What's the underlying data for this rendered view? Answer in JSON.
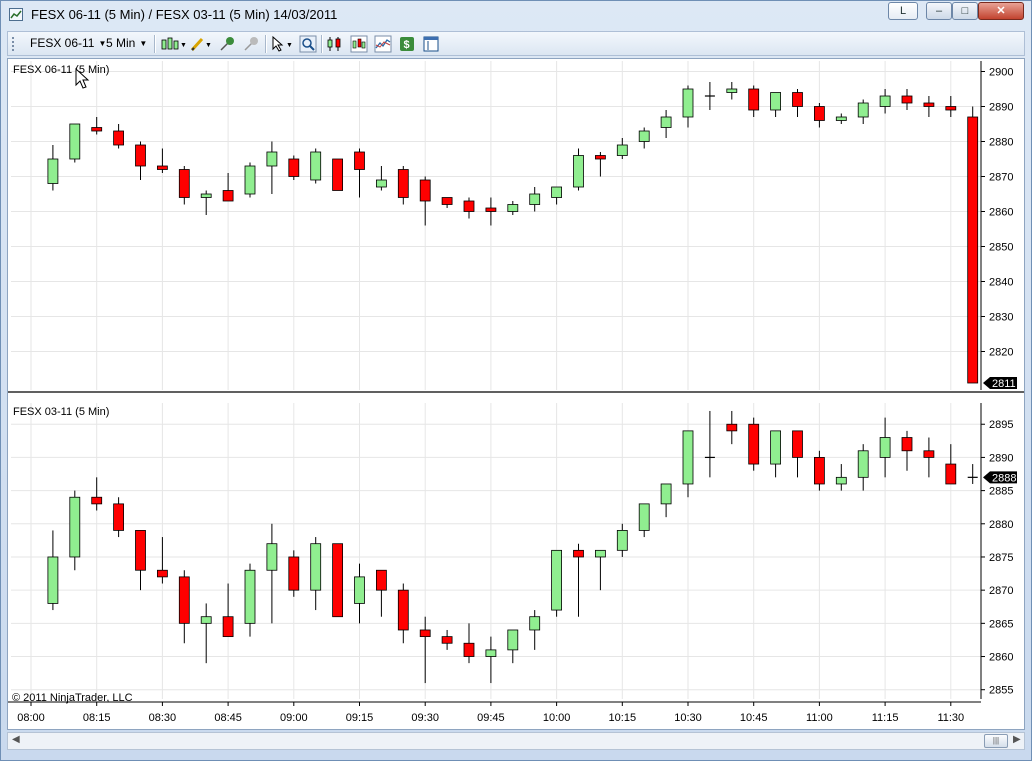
{
  "window": {
    "title": "FESX 06-11 (5 Min) / FESX 03-11 (5 Min)  14/03/2011",
    "link_button_label": "L"
  },
  "toolbar": {
    "instrument": "FESX 06-11",
    "interval": "5 Min",
    "icons": [
      "bar-type-icon",
      "pencil-draw-icon",
      "pin-icon",
      "pin-gray-icon",
      "cursor-icon",
      "zoom-icon",
      "data-box-icon",
      "chart-style-icon",
      "indicators-icon",
      "strategy-dollar-icon",
      "properties-icon"
    ]
  },
  "colors": {
    "up": "#90ee90",
    "down": "#ff0000",
    "grid": "#e6e6e6",
    "divider": "#000000"
  },
  "footer": {
    "copyright": "© 2011 NinjaTrader, LLC"
  },
  "chart_data": [
    {
      "type": "candlestick",
      "title": "FESX 06-11 (5 Min)",
      "yticks": [
        2820,
        2830,
        2840,
        2850,
        2860,
        2870,
        2880,
        2890,
        2900
      ],
      "ylim": [
        2809,
        2903
      ],
      "last_price": "2811",
      "x": [
        "08:05",
        "08:10",
        "08:15",
        "08:20",
        "08:25",
        "08:30",
        "08:35",
        "08:40",
        "08:45",
        "08:50",
        "08:55",
        "09:00",
        "09:05",
        "09:10",
        "09:15",
        "09:20",
        "09:25",
        "09:30",
        "09:35",
        "09:40",
        "09:45",
        "09:50",
        "09:55",
        "10:00",
        "10:05",
        "10:10",
        "10:15",
        "10:20",
        "10:25",
        "10:30",
        "10:35",
        "10:40",
        "10:45",
        "10:50",
        "10:55",
        "11:00",
        "11:05",
        "11:10",
        "11:15",
        "11:20",
        "11:25",
        "11:30",
        "11:35"
      ],
      "open": [
        2868,
        2875,
        2884,
        2883,
        2879,
        2873,
        2872,
        2864,
        2866,
        2865,
        2873,
        2875,
        2869,
        2875,
        2877,
        2867,
        2872,
        2869,
        2864,
        2863,
        2861,
        2860,
        2862,
        2864,
        2867,
        2876,
        2876,
        2880,
        2884,
        2887,
        2893,
        2894,
        2895,
        2889,
        2894,
        2890,
        2886,
        2887,
        2890,
        2893,
        2891,
        2890,
        2887
      ],
      "high": [
        2879,
        2885,
        2887,
        2885,
        2880,
        2878,
        2873,
        2866,
        2871,
        2874,
        2880,
        2876,
        2878,
        2875,
        2878,
        2873,
        2873,
        2870,
        2864,
        2864,
        2864,
        2863,
        2867,
        2867,
        2878,
        2877,
        2881,
        2884,
        2889,
        2896,
        2897,
        2897,
        2896,
        2891,
        2895,
        2891,
        2888,
        2892,
        2895,
        2895,
        2893,
        2893,
        2890
      ],
      "low": [
        2866,
        2874,
        2882,
        2878,
        2869,
        2871,
        2862,
        2859,
        2863,
        2864,
        2865,
        2869,
        2868,
        2866,
        2864,
        2866,
        2862,
        2856,
        2861,
        2858,
        2856,
        2859,
        2860,
        2862,
        2866,
        2870,
        2875,
        2878,
        2881,
        2884,
        2889,
        2892,
        2887,
        2887,
        2887,
        2884,
        2885,
        2885,
        2888,
        2889,
        2887,
        2887,
        2885
      ],
      "close": [
        2875,
        2885,
        2883,
        2879,
        2873,
        2872,
        2864,
        2865,
        2863,
        2873,
        2877,
        2870,
        2877,
        2866,
        2872,
        2869,
        2864,
        2863,
        2862,
        2860,
        2860,
        2862,
        2865,
        2867,
        2876,
        2875,
        2879,
        2883,
        2887,
        2895,
        2893,
        2895,
        2889,
        2894,
        2890,
        2886,
        2887,
        2891,
        2893,
        2891,
        2890,
        2889,
        2811
      ]
    },
    {
      "type": "candlestick",
      "title": "FESX 03-11 (5 Min)",
      "yticks": [
        2855,
        2860,
        2865,
        2870,
        2875,
        2880,
        2885,
        2890,
        2895
      ],
      "ylim": [
        2853.6,
        2898.2
      ],
      "last_price": "2888",
      "x": [
        "08:05",
        "08:10",
        "08:15",
        "08:20",
        "08:25",
        "08:30",
        "08:35",
        "08:40",
        "08:45",
        "08:50",
        "08:55",
        "09:00",
        "09:05",
        "09:10",
        "09:15",
        "09:20",
        "09:25",
        "09:30",
        "09:35",
        "09:40",
        "09:45",
        "09:50",
        "09:55",
        "10:00",
        "10:05",
        "10:10",
        "10:15",
        "10:20",
        "10:25",
        "10:30",
        "10:35",
        "10:40",
        "10:45",
        "10:50",
        "10:55",
        "11:00",
        "11:05",
        "11:10",
        "11:15",
        "11:20",
        "11:25",
        "11:30",
        "11:35"
      ],
      "open": [
        2868,
        2875,
        2884,
        2883,
        2879,
        2873,
        2872,
        2865,
        2866,
        2865,
        2873,
        2875,
        2870,
        2877,
        2868,
        2873,
        2870,
        2864,
        2863,
        2862,
        2860,
        2861,
        2864,
        2867,
        2876,
        2875,
        2876,
        2879,
        2883,
        2886,
        2890,
        2895,
        2895,
        2889,
        2894,
        2890,
        2886,
        2887,
        2890,
        2893,
        2891,
        2889,
        2887
      ],
      "high": [
        2879,
        2885,
        2887,
        2884,
        2879,
        2878,
        2873,
        2868,
        2871,
        2874,
        2880,
        2876,
        2878,
        2877,
        2874,
        2873,
        2871,
        2866,
        2864,
        2865,
        2863,
        2863,
        2867,
        2868,
        2877,
        2876,
        2880,
        2881,
        2885,
        2894,
        2897,
        2897,
        2896,
        2894,
        2894,
        2891,
        2889,
        2892,
        2896,
        2894,
        2893,
        2892,
        2889
      ],
      "low": [
        2867,
        2873,
        2882,
        2878,
        2870,
        2871,
        2862,
        2859,
        2863,
        2863,
        2865,
        2869,
        2867,
        2866,
        2865,
        2866,
        2862,
        2856,
        2861,
        2859,
        2856,
        2859,
        2861,
        2866,
        2866,
        2870,
        2875,
        2878,
        2881,
        2884,
        2887,
        2892,
        2888,
        2887,
        2887,
        2885,
        2885,
        2885,
        2887,
        2888,
        2887,
        2887,
        2886
      ],
      "close": [
        2875,
        2884,
        2883,
        2879,
        2873,
        2872,
        2865,
        2866,
        2863,
        2873,
        2877,
        2870,
        2877,
        2866,
        2872,
        2870,
        2864,
        2863,
        2862,
        2860,
        2861,
        2864,
        2866,
        2876,
        2875,
        2876,
        2879,
        2883,
        2886,
        2894,
        2890,
        2894,
        2889,
        2894,
        2890,
        2886,
        2887,
        2891,
        2893,
        2891,
        2890,
        2886,
        2887
      ]
    }
  ],
  "x_axis": {
    "labels": [
      "08:00",
      "08:15",
      "08:30",
      "08:45",
      "09:00",
      "09:15",
      "09:30",
      "09:45",
      "10:00",
      "10:15",
      "10:30",
      "10:45",
      "11:00",
      "11:15",
      "11:30"
    ]
  }
}
